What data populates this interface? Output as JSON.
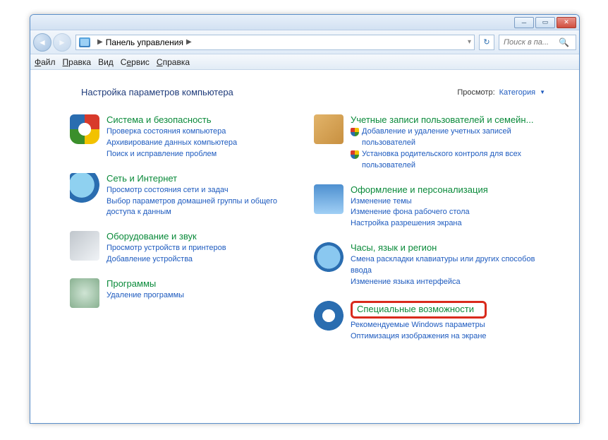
{
  "address": {
    "title": "Панель управления"
  },
  "search": {
    "placeholder": "Поиск в па..."
  },
  "menu": {
    "file": "Файл",
    "edit": "Правка",
    "view": "Вид",
    "tools": "Сервис",
    "help": "Справка"
  },
  "page_title": "Настройка параметров компьютера",
  "view_label": "Просмотр:",
  "view_value": "Категория",
  "left": {
    "c1": {
      "title": "Система и безопасность",
      "l1": "Проверка состояния компьютера",
      "l2": "Архивирование данных компьютера",
      "l3": "Поиск и исправление проблем"
    },
    "c2": {
      "title": "Сеть и Интернет",
      "l1": "Просмотр состояния сети и задач",
      "l2": "Выбор параметров домашней группы и общего доступа к данным"
    },
    "c3": {
      "title": "Оборудование и звук",
      "l1": "Просмотр устройств и принтеров",
      "l2": "Добавление устройства"
    },
    "c4": {
      "title": "Программы",
      "l1": "Удаление программы"
    }
  },
  "right": {
    "c1": {
      "title": "Учетные записи пользователей и семейн...",
      "l1": "Добавление и удаление учетных записей пользователей",
      "l2": "Установка родительского контроля для всех пользователей"
    },
    "c2": {
      "title": "Оформление и персонализация",
      "l1": "Изменение темы",
      "l2": "Изменение фона рабочего стола",
      "l3": "Настройка разрешения экрана"
    },
    "c3": {
      "title": "Часы, язык и регион",
      "l1": "Смена раскладки клавиатуры или других способов ввода",
      "l2": "Изменение языка интерфейса"
    },
    "c4": {
      "title": "Специальные возможности",
      "l1": "Рекомендуемые Windows параметры",
      "l2": "Оптимизация изображения на экране"
    }
  },
  "highlight_target": "right.c4.title"
}
